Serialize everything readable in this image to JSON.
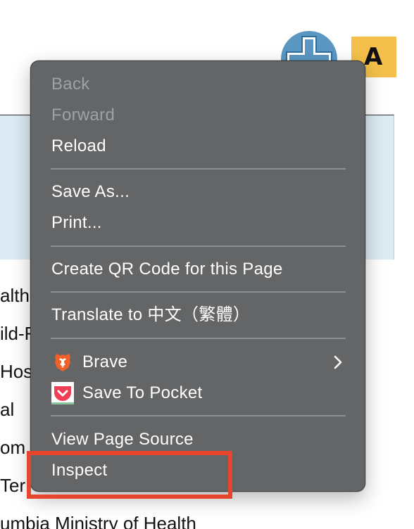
{
  "background_page": {
    "badge_letter": "A",
    "list_items": [
      "alth",
      "ild-F",
      "Hos",
      "al",
      "om",
      "Ter",
      "umbia Ministry of Health"
    ],
    "colors": {
      "band": "#ddebf4",
      "avatar": "#5b97c2",
      "badge": "#f4c04b"
    },
    "avatar_icon": "plus-cross-icon"
  },
  "context_menu": {
    "groups": [
      {
        "items": [
          {
            "label": "Back",
            "enabled": false
          },
          {
            "label": "Forward",
            "enabled": false
          },
          {
            "label": "Reload",
            "enabled": true
          }
        ]
      },
      {
        "items": [
          {
            "label": "Save As...",
            "enabled": true
          },
          {
            "label": "Print...",
            "enabled": true
          }
        ]
      },
      {
        "items": [
          {
            "label": "Create QR Code for this Page",
            "enabled": true
          }
        ]
      },
      {
        "items": [
          {
            "label": "Translate to 中文（繁體）",
            "enabled": true
          }
        ]
      },
      {
        "items": [
          {
            "label": "Brave",
            "enabled": true,
            "icon": "brave-lion-icon",
            "has_submenu": true
          },
          {
            "label": "Save To Pocket",
            "enabled": true,
            "icon": "pocket-icon"
          }
        ]
      },
      {
        "items": [
          {
            "label": "View Page Source",
            "enabled": true
          },
          {
            "label": "Inspect",
            "enabled": true,
            "highlighted": true
          }
        ]
      }
    ],
    "colors": {
      "background": "#636567",
      "text": "#ffffff",
      "disabled_text": "#9fa1a3",
      "separator": "#8b8d8f",
      "highlight_outline": "#e8452f"
    }
  }
}
